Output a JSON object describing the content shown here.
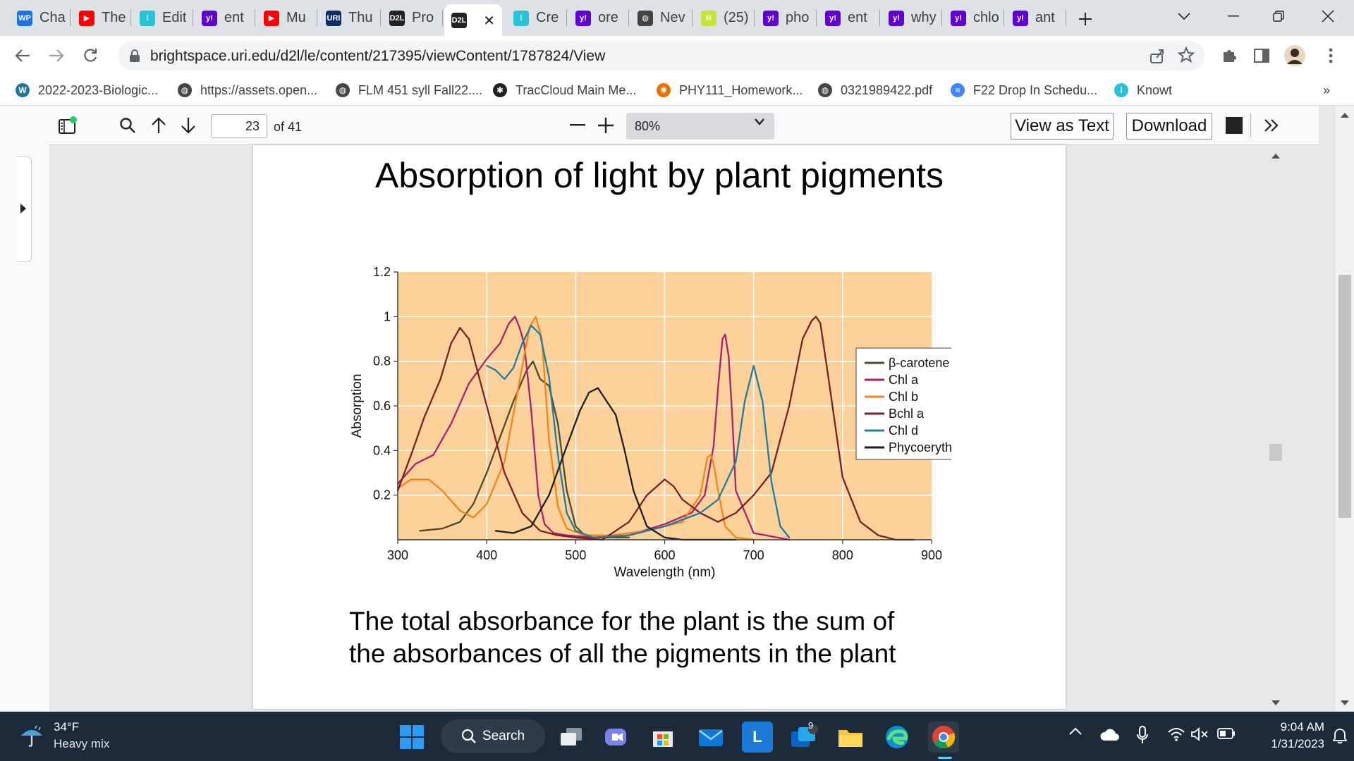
{
  "browser": {
    "tabs": [
      {
        "favicon": "wp-icon",
        "badge": "WP",
        "color": "#1a73e8",
        "title": "Cha"
      },
      {
        "favicon": "youtube-icon",
        "badge": "▶",
        "color": "#ff0000",
        "title": "The"
      },
      {
        "favicon": "brightspace-icon",
        "badge": "⁞",
        "color": "#27c4d8",
        "title": "Edit"
      },
      {
        "favicon": "yahoo-icon",
        "badge": "y!",
        "color": "#6001d2",
        "title": "ent"
      },
      {
        "favicon": "youtube-icon",
        "badge": "▶",
        "color": "#ff0000",
        "title": "Mu"
      },
      {
        "favicon": "uri-icon",
        "badge": "URI",
        "color": "#0b2f6b",
        "title": "Thu"
      },
      {
        "favicon": "d2l-icon",
        "badge": "D2L",
        "color": "#222222",
        "title": "Pro"
      },
      {
        "favicon": "d2l-icon",
        "badge": "D2L",
        "color": "#222222",
        "title": "",
        "active": true
      },
      {
        "favicon": "brightspace-icon",
        "badge": "⁞",
        "color": "#27c4d8",
        "title": "Cre"
      },
      {
        "favicon": "yahoo-icon",
        "badge": "y!",
        "color": "#6001d2",
        "title": "ore"
      },
      {
        "favicon": "globe-icon",
        "badge": "◍",
        "color": "#444444",
        "title": "Nev"
      },
      {
        "favicon": "h-icon",
        "badge": "H",
        "color": "#c4e538",
        "title": "(25)"
      },
      {
        "favicon": "yahoo-icon",
        "badge": "y!",
        "color": "#6001d2",
        "title": "pho"
      },
      {
        "favicon": "yahoo-icon",
        "badge": "y!",
        "color": "#6001d2",
        "title": "ent"
      },
      {
        "favicon": "yahoo-icon",
        "badge": "y!",
        "color": "#6001d2",
        "title": "why"
      },
      {
        "favicon": "yahoo-icon",
        "badge": "y!",
        "color": "#6001d2",
        "title": "chlo"
      },
      {
        "favicon": "yahoo-icon",
        "badge": "y!",
        "color": "#6001d2",
        "title": "ant"
      }
    ],
    "url": "brightspace.uri.edu/d2l/le/content/217395/viewContent/1787824/View",
    "bookmarks": [
      {
        "icon": "wordpress-icon",
        "color": "#21759b",
        "glyph": "W",
        "label": "2022-2023-Biologic..."
      },
      {
        "icon": "globe-icon",
        "color": "#444444",
        "glyph": "◍",
        "label": "https://assets.open..."
      },
      {
        "icon": "globe-icon",
        "color": "#444444",
        "glyph": "◍",
        "label": "FLM 451 syll Fall22...."
      },
      {
        "icon": "traccloud-icon",
        "color": "#222222",
        "glyph": "✱",
        "label": "TracCloud Main Me..."
      },
      {
        "icon": "homework-icon",
        "color": "#e37400",
        "glyph": "✺",
        "label": "PHY111_Homework..."
      },
      {
        "icon": "globe-icon",
        "color": "#444444",
        "glyph": "◍",
        "label": "0321989422.pdf"
      },
      {
        "icon": "docs-icon",
        "color": "#4285f4",
        "glyph": "≡",
        "label": "F22 Drop In Schedu..."
      },
      {
        "icon": "brightspace-icon",
        "color": "#27c4d8",
        "glyph": "⁞",
        "label": "Knowt"
      }
    ]
  },
  "pdf": {
    "page_number": "23",
    "page_count": "of 41",
    "zoom": "80%",
    "view_as_text": "View as Text",
    "download": "Download"
  },
  "slide": {
    "title": "Absorption of light by plant pigments",
    "caption_line1": "The total absorbance for the plant is the sum of",
    "caption_line2": "the absorbances of all the pigments in the plant"
  },
  "chart_data": {
    "type": "line",
    "title": "",
    "xlabel": "Wavelength (nm)",
    "ylabel": "Absorption",
    "xlim": [
      300,
      900
    ],
    "ylim": [
      0,
      1.2
    ],
    "xticks": [
      "300",
      "400",
      "500",
      "600",
      "700",
      "800",
      "900"
    ],
    "yticks": [
      "0.2",
      "0.4",
      "0.6",
      "0.8",
      "1",
      "1.2"
    ],
    "background": "#fdd29a",
    "grid": true,
    "legend_position": "right",
    "series": [
      {
        "name": "β-carotene",
        "color": "#4f4a2a",
        "x": [
          325,
          350,
          370,
          385,
          400,
          415,
          430,
          445,
          452,
          460,
          470,
          480,
          490,
          500,
          510,
          520,
          540,
          560
        ],
        "y": [
          0.04,
          0.05,
          0.08,
          0.16,
          0.3,
          0.46,
          0.62,
          0.76,
          0.8,
          0.72,
          0.69,
          0.52,
          0.22,
          0.06,
          0.02,
          0.01,
          0.01,
          0.01
        ]
      },
      {
        "name": "Chl a",
        "color": "#a8206e",
        "x": [
          300,
          320,
          340,
          360,
          380,
          400,
          415,
          425,
          432,
          437,
          442,
          450,
          458,
          465,
          475,
          490,
          520,
          560,
          600,
          630,
          645,
          655,
          660,
          665,
          668,
          672,
          676,
          680,
          700,
          740
        ],
        "y": [
          0.25,
          0.34,
          0.38,
          0.52,
          0.7,
          0.81,
          0.88,
          0.97,
          1.0,
          0.95,
          0.88,
          0.58,
          0.2,
          0.07,
          0.03,
          0.02,
          0.01,
          0.02,
          0.07,
          0.12,
          0.2,
          0.42,
          0.68,
          0.9,
          0.92,
          0.82,
          0.55,
          0.22,
          0.03,
          0.0
        ]
      },
      {
        "name": "Chl b",
        "color": "#f08418",
        "x": [
          300,
          315,
          335,
          350,
          370,
          385,
          400,
          420,
          435,
          448,
          455,
          462,
          470,
          480,
          490,
          510,
          540,
          580,
          620,
          640,
          648,
          652,
          656,
          660,
          668,
          680,
          700
        ],
        "y": [
          0.23,
          0.27,
          0.27,
          0.22,
          0.13,
          0.1,
          0.16,
          0.35,
          0.67,
          0.95,
          1.0,
          0.9,
          0.45,
          0.15,
          0.05,
          0.02,
          0.02,
          0.04,
          0.08,
          0.2,
          0.37,
          0.38,
          0.32,
          0.22,
          0.06,
          0.01,
          0.0
        ]
      },
      {
        "name": "Bchl a",
        "color": "#7a1f24",
        "x": [
          300,
          315,
          330,
          348,
          360,
          370,
          380,
          400,
          420,
          440,
          460,
          480,
          500,
          530,
          560,
          580,
          600,
          610,
          620,
          640,
          660,
          680,
          700,
          720,
          740,
          755,
          765,
          770,
          775,
          785,
          800,
          820,
          840,
          860,
          880
        ],
        "y": [
          0.22,
          0.38,
          0.55,
          0.72,
          0.88,
          0.95,
          0.9,
          0.6,
          0.3,
          0.12,
          0.04,
          0.02,
          0.01,
          0.0,
          0.08,
          0.2,
          0.27,
          0.24,
          0.18,
          0.12,
          0.08,
          0.12,
          0.2,
          0.3,
          0.6,
          0.9,
          0.98,
          1.0,
          0.97,
          0.7,
          0.28,
          0.08,
          0.02,
          0.0,
          0.0
        ]
      },
      {
        "name": "Chl d",
        "color": "#1f7ba0",
        "x": [
          400,
          410,
          420,
          430,
          440,
          450,
          460,
          470,
          480,
          490,
          500,
          520,
          560,
          600,
          640,
          660,
          680,
          690,
          700,
          710,
          720,
          730,
          740
        ],
        "y": [
          0.78,
          0.76,
          0.72,
          0.77,
          0.88,
          0.96,
          0.92,
          0.73,
          0.38,
          0.12,
          0.04,
          0.01,
          0.02,
          0.06,
          0.12,
          0.18,
          0.35,
          0.62,
          0.78,
          0.62,
          0.26,
          0.06,
          0.01
        ]
      },
      {
        "name": "Phycoerythrobilin",
        "color": "#1e1e1e",
        "x": [
          410,
          430,
          450,
          470,
          490,
          505,
          515,
          525,
          530,
          535,
          545,
          555,
          565,
          580,
          600,
          620,
          640,
          660,
          680
        ],
        "y": [
          0.04,
          0.03,
          0.06,
          0.2,
          0.42,
          0.58,
          0.66,
          0.68,
          0.65,
          0.62,
          0.56,
          0.4,
          0.22,
          0.06,
          0.01,
          0.0,
          0.0,
          0.0,
          0.0
        ]
      }
    ]
  },
  "taskbar": {
    "weather_temp": "34°F",
    "weather_desc": "Heavy mix",
    "search_label": "Search",
    "time": "9:04 AM",
    "date": "1/31/2023",
    "notification_count": "9"
  }
}
